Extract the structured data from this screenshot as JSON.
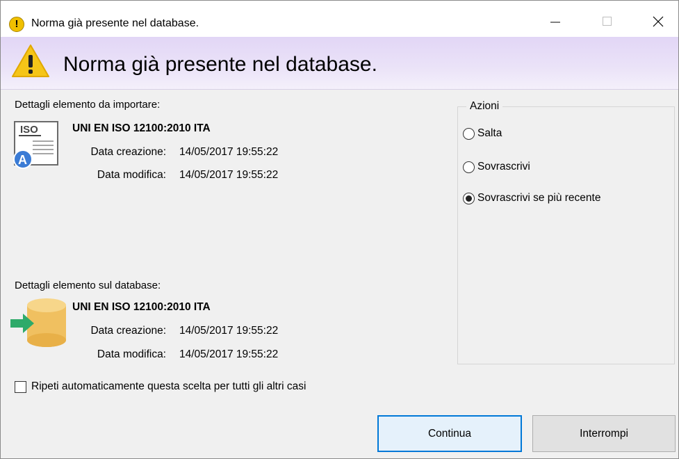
{
  "window": {
    "title": "Norma già presente nel database.",
    "controls": {
      "minimize": "—",
      "maximize": "☐",
      "close": "✕"
    }
  },
  "header": {
    "text": "Norma già presente nel database.",
    "icon": "warning-icon"
  },
  "import_section": {
    "caption": "Dettagli elemento da importare:",
    "icon": "iso-document-icon",
    "icon_label": "ISO",
    "badge": "A",
    "name": "UNI EN ISO 12100:2010 ITA",
    "created_label": "Data creazione:",
    "created_value": "14/05/2017 19:55:22",
    "modified_label": "Data modifica:",
    "modified_value": "14/05/2017 19:55:22"
  },
  "database_section": {
    "caption": "Dettagli elemento sul database:",
    "icon": "database-arrow-icon",
    "name": "UNI EN ISO 12100:2010 ITA",
    "created_label": "Data creazione:",
    "created_value": "14/05/2017 19:55:22",
    "modified_label": "Data modifica:",
    "modified_value": "14/05/2017 19:55:22"
  },
  "actions": {
    "title": "Azioni",
    "options": [
      {
        "label": "Salta",
        "checked": false
      },
      {
        "label": "Sovrascrivi",
        "checked": false
      },
      {
        "label": "Sovrascrivi se più recente",
        "checked": true
      }
    ]
  },
  "repeat_checkbox": {
    "label": "Ripeti automaticamente questa scelta per tutti gli altri casi",
    "checked": false
  },
  "buttons": {
    "continue": "Continua",
    "stop": "Interrompi"
  },
  "colors": {
    "header_gradient": "#e2d6f6",
    "warning": "#f5c518",
    "database": "#f0c060",
    "arrow": "#2eaa6a",
    "focus_border": "#0078d7"
  }
}
